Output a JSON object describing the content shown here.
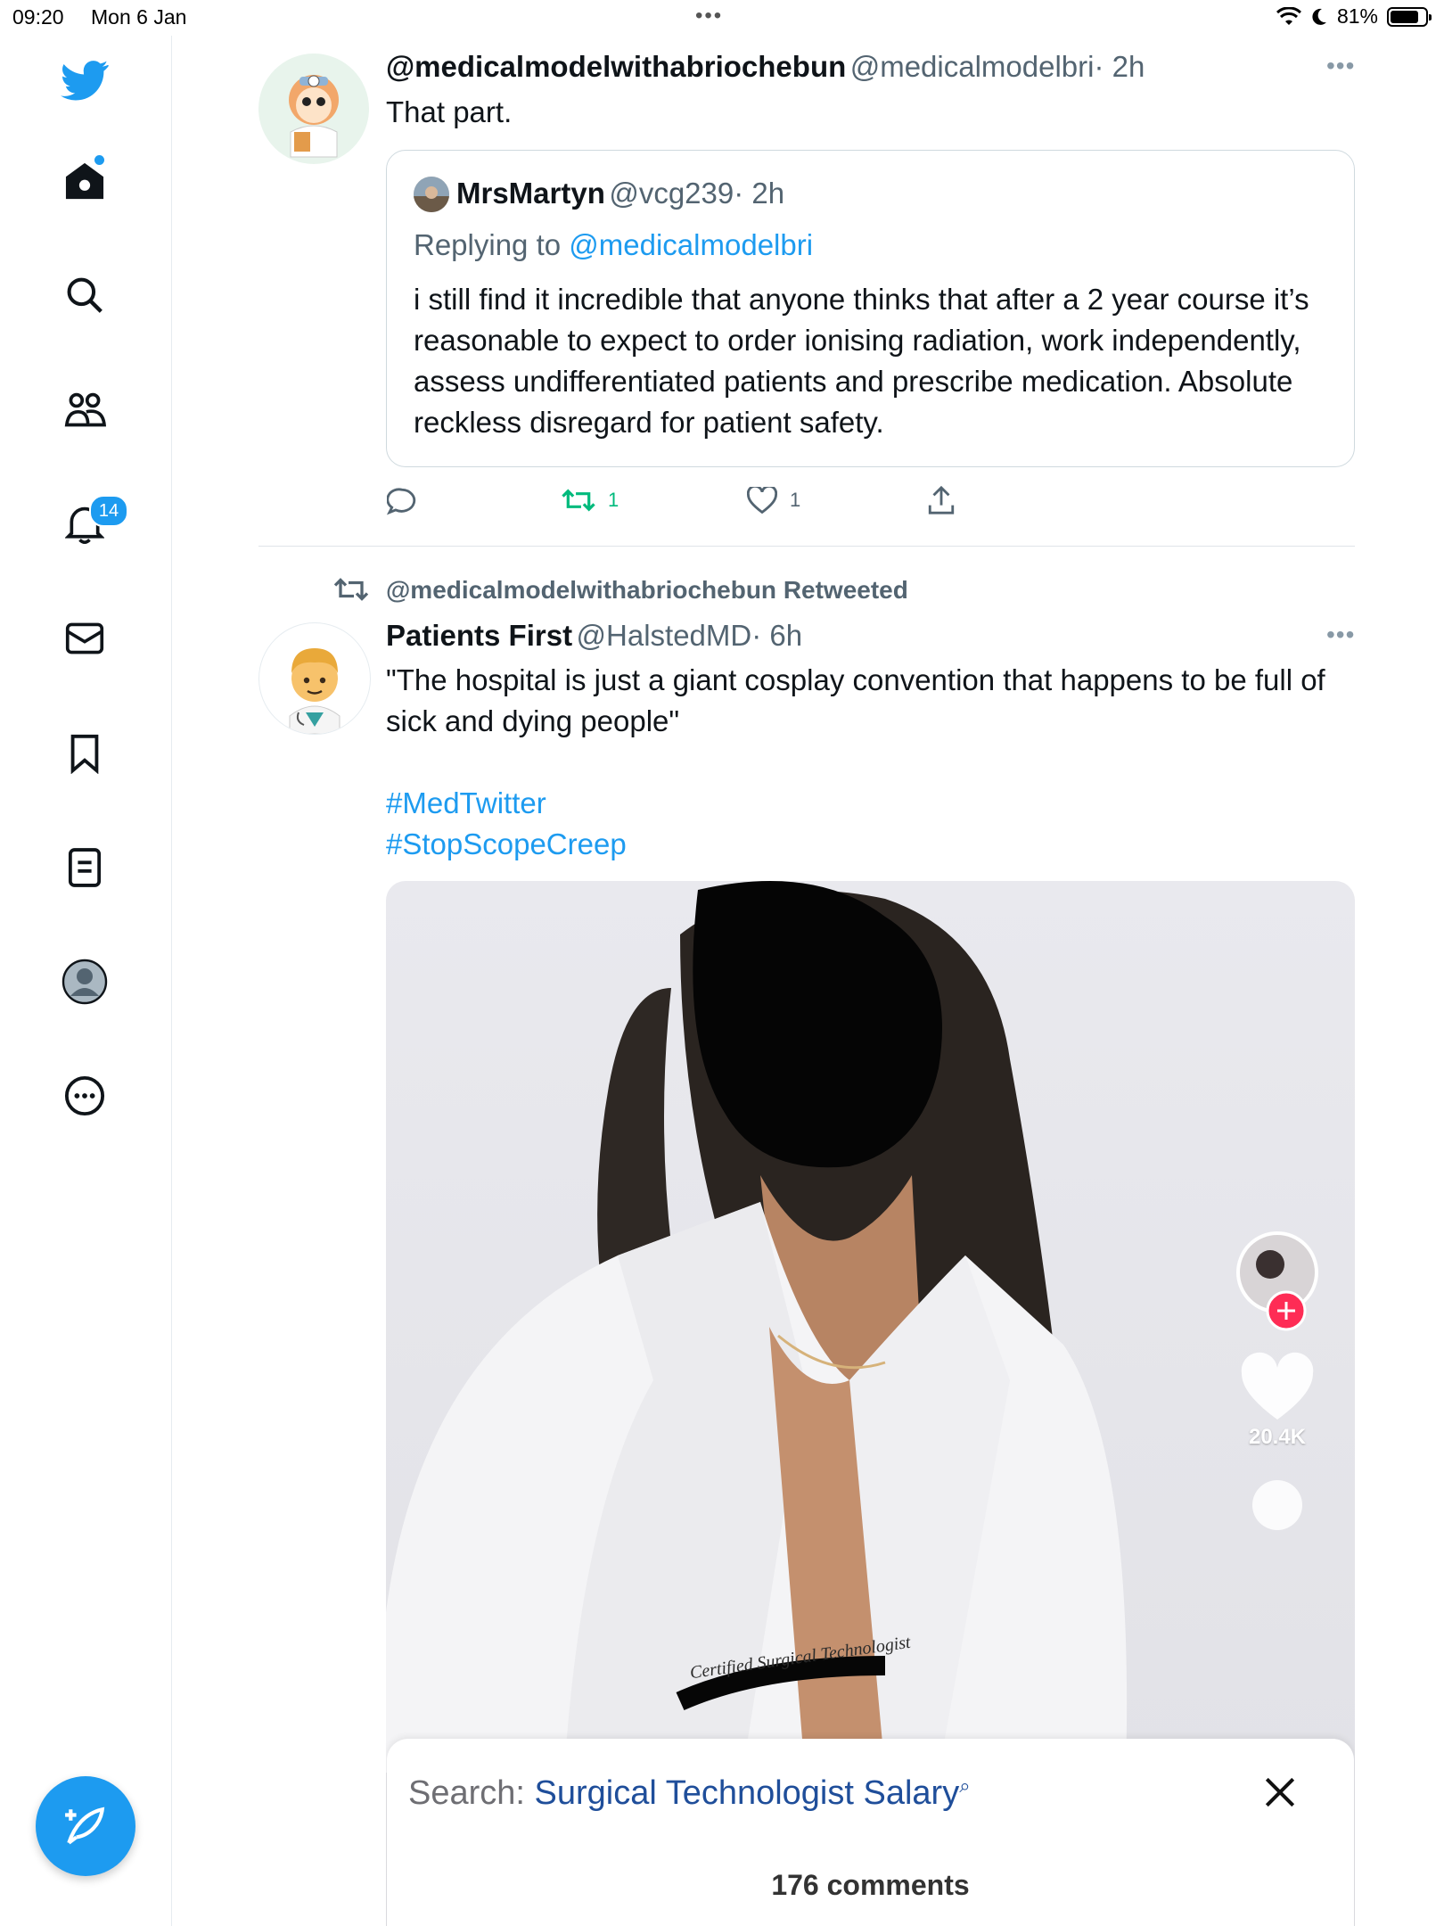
{
  "status_bar": {
    "time": "09:20",
    "date": "Mon 6 Jan",
    "battery": "81%",
    "battery_level": 0.81
  },
  "colors": {
    "accent": "#1d9bf0",
    "retweet_green": "#00ba7c",
    "text_secondary": "#536471",
    "tiktok_red": "#fe2c55"
  },
  "sidebar": {
    "items": [
      {
        "icon": "twitter-logo-icon"
      },
      {
        "icon": "home-icon"
      },
      {
        "icon": "search-icon"
      },
      {
        "icon": "communities-icon"
      },
      {
        "icon": "notifications-icon",
        "badge": "14"
      },
      {
        "icon": "messages-icon"
      },
      {
        "icon": "bookmarks-icon"
      },
      {
        "icon": "lists-icon"
      },
      {
        "icon": "profile-icon"
      },
      {
        "icon": "more-icon"
      }
    ],
    "compose_icon": "compose-tweet-icon"
  },
  "tweet1": {
    "name": "@medicalmodelwithabriochebun",
    "handle": "@medicalmodelbri",
    "time": "· 2h",
    "text": "That part.",
    "quote": {
      "name": "MrsMartyn",
      "handle": "@vcg239",
      "time": "· 2h",
      "replying_prefix": "Replying to",
      "replying_to": "@medicalmodelbri",
      "text": "i still find it incredible that anyone thinks that after a 2 year course it’s reasonable to expect to order ionising radiation, work independently, assess undifferentiated patients and prescribe medication. Absolute reckless disregard for patient safety."
    },
    "actions": {
      "retweets": "1",
      "likes": "1"
    }
  },
  "tweet2": {
    "retweeted_by": "@medicalmodelwithabriochebun Retweeted",
    "name": "Patients First",
    "handle": "@HalstedMD",
    "time": "· 6h",
    "text": "\"The hospital is just a giant cosplay convention that happens to be full of sick and dying people\"",
    "hashtags": [
      "#MedTwitter",
      "#StopScopeCreep"
    ],
    "media": {
      "badge_text": "Certified Surgical Technologist",
      "likes": "20.4K",
      "search_label": "Search:",
      "search_query": "Surgical Technologist Salary",
      "comments": "176 comments"
    }
  }
}
